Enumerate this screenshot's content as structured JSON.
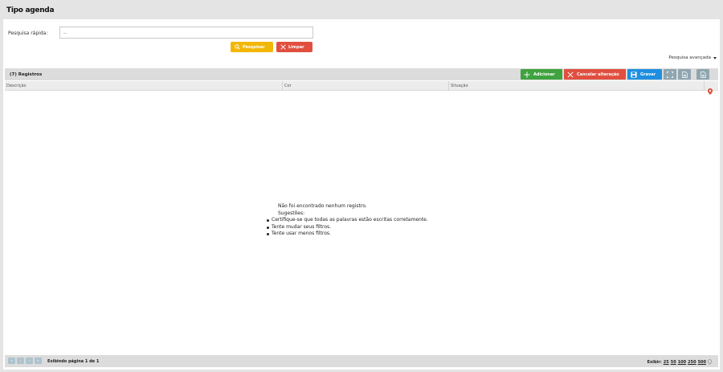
{
  "page": {
    "title": "Tipo agenda"
  },
  "quick_search": {
    "label": "Pesquisa rápida:",
    "value": "..",
    "search_label": "Pesquisar",
    "clear_label": "Limpar",
    "advanced_label": "Pesquisa avançada"
  },
  "toolbar": {
    "records_label": "(7) Registros",
    "add_label": "Adicionar",
    "cancel_label": "Cancelar alteração",
    "save_label": "Gravar"
  },
  "table": {
    "columns": [
      "Descrição",
      "Cor",
      "Situação"
    ]
  },
  "empty_state": {
    "message": "Não foi encontrado nenhum registro.",
    "suggestions_title": "Sugestões:",
    "suggestions": [
      "Certifique-se que todas as palavras estão escritas corretamente.",
      "Tente mudar seus filtros.",
      "Tente usar menos filtros."
    ]
  },
  "pagination": {
    "info": "Exibindo página 1 de 1",
    "show_label": "Exibir:",
    "page_sizes": [
      "25",
      "50",
      "100",
      "250",
      "500"
    ]
  },
  "colors": {
    "search_button": "#f2b705",
    "danger": "#e04f3f",
    "add": "#3fa33f",
    "save": "#1e8fe0",
    "pin": "#e04f3f"
  },
  "icons": {
    "search": "search-icon",
    "clear": "close-icon",
    "add": "plus-icon",
    "cancel": "close-icon",
    "save": "floppy-disk-icon",
    "fullscreen": "fullscreen-icon",
    "export1": "document-icon",
    "export2": "document-icon",
    "pin": "map-pin-icon",
    "advanced": "caret-down-icon"
  }
}
